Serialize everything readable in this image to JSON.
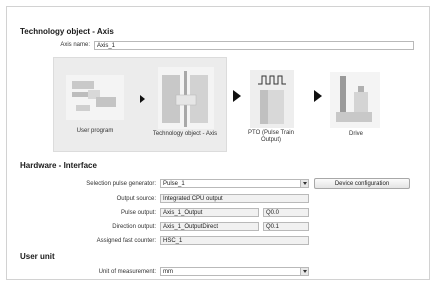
{
  "tech_object": {
    "title": "Technology object - Axis",
    "axis_name_label": "Axis name:",
    "axis_name_value": "Axis_1"
  },
  "diagram": {
    "user_program": "User program",
    "technology_object": "Technology object - Axis",
    "pto": "PTO (Pulse Train Output)",
    "drive": "Drive"
  },
  "hardware": {
    "title": "Hardware - Interface",
    "pulse_generator_label": "Selection pulse generator:",
    "pulse_generator_value": "Pulse_1",
    "device_config_button": "Device configuration",
    "output_source_label": "Output source:",
    "output_source_value": "Integrated CPU output",
    "pulse_output_label": "Pulse output:",
    "pulse_output_value": "Axis_1_Output",
    "pulse_output_addr": "Q0.0",
    "direction_output_label": "Direction output:",
    "direction_output_value": "Axis_1_OutputDirect",
    "direction_output_addr": "Q0.1",
    "fast_counter_label": "Assigned fast counter:",
    "fast_counter_value": "HSC_1"
  },
  "user_unit": {
    "title": "User unit",
    "measurement_label": "Unit of measurement:",
    "measurement_value": "mm"
  },
  "icons": [
    "user-program-icon",
    "technology-object-icon",
    "pto-icon",
    "drive-icon",
    "dropdown-arrow-icon"
  ]
}
